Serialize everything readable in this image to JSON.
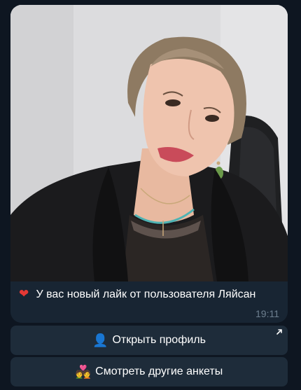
{
  "message": {
    "heart_icon": "❤",
    "text": "У вас новый лайк от пользователя Ляйсан",
    "time": "19:11"
  },
  "buttons": [
    {
      "icon": "👤",
      "label": "Открыть профиль"
    },
    {
      "icon": "💑",
      "label": "Смотреть другие анкеты"
    }
  ],
  "colors": {
    "background": "#0e1621",
    "bubble": "#182533",
    "button": "#1e2c3a",
    "time": "#6d7f8f"
  }
}
